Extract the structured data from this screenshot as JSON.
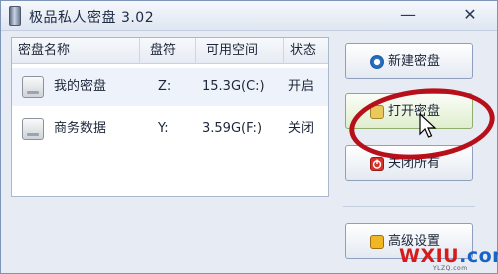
{
  "window": {
    "title": "极品私人密盘 3.02",
    "minimize_glyph": "—",
    "close_glyph": "✕"
  },
  "table": {
    "columns": [
      "密盘名称",
      "盘符",
      "可用空间",
      "状态"
    ],
    "rows": [
      {
        "name": "我的密盘",
        "drive": "Z:",
        "space": "15.3G(C:)",
        "status": "开启"
      },
      {
        "name": "商务数据",
        "drive": "Y:",
        "space": "3.59G(F:)",
        "status": "关闭"
      }
    ]
  },
  "buttons": {
    "new_disk": "新建密盘",
    "open_disk": "打开密盘",
    "close_all": "关闭所有",
    "advanced": "高级设置"
  },
  "icons": {
    "new_disk": "new-disk-icon",
    "open_disk": "folder-icon",
    "close_all": "power-icon",
    "advanced": "settings-icon",
    "disk": "disk-icon"
  },
  "watermark": {
    "brand": "WXIU",
    "domain": ".com",
    "sub": "YLZQ.com"
  },
  "colors": {
    "accent": "#b8101a",
    "hover_green": "#dfeecd"
  }
}
